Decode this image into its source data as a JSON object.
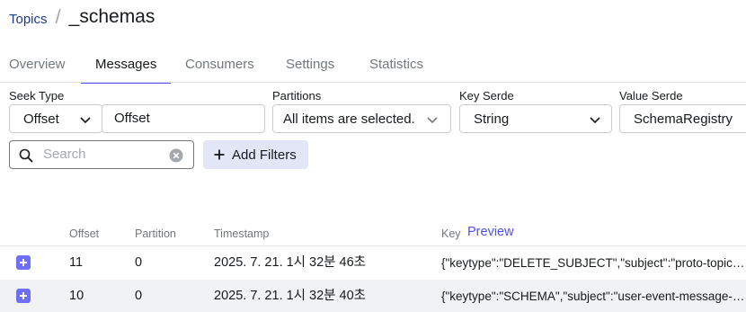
{
  "breadcrumb": {
    "parent": "Topics",
    "separator": "/",
    "title": "_schemas"
  },
  "tabs": [
    {
      "label": "Overview",
      "active": false
    },
    {
      "label": "Messages",
      "active": true
    },
    {
      "label": "Consumers",
      "active": false
    },
    {
      "label": "Settings",
      "active": false
    },
    {
      "label": "Statistics",
      "active": false
    }
  ],
  "filters": {
    "seek_type": {
      "label": "Seek Type",
      "value": "Offset"
    },
    "offset": {
      "value": "Offset"
    },
    "partitions": {
      "label": "Partitions",
      "value": "All items are selected."
    },
    "key_serde": {
      "label": "Key Serde",
      "value": "String"
    },
    "value_serde": {
      "label": "Value Serde",
      "value": "SchemaRegistry"
    }
  },
  "search": {
    "placeholder": "Search",
    "icon": "search-icon",
    "clear_icon": "clear-icon"
  },
  "add_filters": {
    "label": "Add Filters",
    "icon": "plus-icon"
  },
  "table": {
    "headers": {
      "offset": "Offset",
      "partition": "Partition",
      "timestamp": "Timestamp",
      "key": "Key",
      "preview": "Preview"
    },
    "rows": [
      {
        "offset": "11",
        "partition": "0",
        "timestamp": "2025. 7. 21. 1시 32분 46초",
        "key": "{\"keytype\":\"DELETE_SUBJECT\",\"subject\":\"proto-topic-value\"}"
      },
      {
        "offset": "10",
        "partition": "0",
        "timestamp": "2025. 7. 21. 1시 32분 40초",
        "key": "{\"keytype\":\"SCHEMA\",\"subject\":\"user-event-message-value\"}"
      }
    ]
  },
  "colors": {
    "accent": "#4f4ffa",
    "link": "#1e3a8a",
    "border": "#c7cbd0",
    "row_alt": "#f1f2f3",
    "button_bg": "#e3e6f7"
  }
}
